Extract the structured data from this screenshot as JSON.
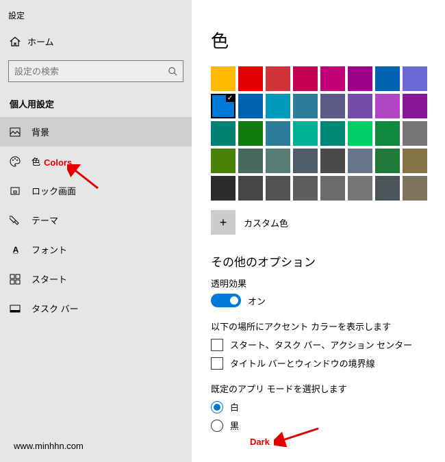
{
  "app_title": "設定",
  "home_label": "ホーム",
  "search_placeholder": "設定の検索",
  "section_title": "個人用設定",
  "nav": [
    {
      "label": "背景",
      "id": "background"
    },
    {
      "label": "色",
      "id": "colors"
    },
    {
      "label": "ロック画面",
      "id": "lockscreen"
    },
    {
      "label": "テーマ",
      "id": "themes"
    },
    {
      "label": "フォント",
      "id": "fonts"
    },
    {
      "label": "スタート",
      "id": "start"
    },
    {
      "label": "タスク バー",
      "id": "taskbar"
    }
  ],
  "page_heading": "色",
  "palette": [
    [
      "#ffb900",
      "#e20000",
      "#d13438",
      "#c30052",
      "#bf0077",
      "#9a0089",
      "#0063b1",
      "#6b69d6"
    ],
    [
      "#0078d7",
      "#0063b1",
      "#0099bc",
      "#2d7d9a",
      "#5d5a88",
      "#744da9",
      "#b146c2",
      "#881798"
    ],
    [
      "#008272",
      "#107c10",
      "#2d7d9a",
      "#00b294",
      "#018574",
      "#00cc6a",
      "#10893e",
      "#767676"
    ],
    [
      "#498205",
      "#486860",
      "#567c73",
      "#515c6b",
      "#4c4a48",
      "#68768a",
      "#207a3c",
      "#847545"
    ],
    [
      "#2b2b2b",
      "#464646",
      "#525252",
      "#5e5e5e",
      "#6b6b6b",
      "#767676",
      "#4a5459",
      "#7e735f"
    ]
  ],
  "selected_swatch": {
    "row": 1,
    "col": 0
  },
  "custom_color_label": "カスタム色",
  "other_options_heading": "その他のオプション",
  "transparency_label": "透明効果",
  "transparency_state": "オン",
  "accent_location_desc": "以下の場所にアクセント カラーを表示します",
  "checkbox_1": "スタート、タスク バー、アクション センター",
  "checkbox_2": "タイトル バーとウィンドウの境界線",
  "app_mode_desc": "既定のアプリ モードを選択します",
  "radio_white": "白",
  "radio_black": "黒",
  "annot_colors": "Colors",
  "annot_dark": "Dark",
  "watermark": "www.minhhn.com"
}
